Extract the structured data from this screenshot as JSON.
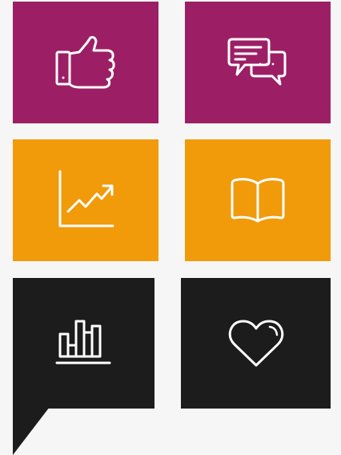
{
  "colors": {
    "background": "#f6f6f6",
    "magenta": "#9c1f66",
    "orange": "#f19a0a",
    "black": "#1c1c1c",
    "icon_stroke": "#ffffff"
  },
  "tiles": [
    {
      "name": "like-tile",
      "color": "magenta",
      "icon": "thumbs-up-icon"
    },
    {
      "name": "chat-tile",
      "color": "magenta",
      "icon": "chat-bubbles-icon"
    },
    {
      "name": "growth-tile",
      "color": "orange",
      "icon": "line-chart-icon"
    },
    {
      "name": "book-tile",
      "color": "orange",
      "icon": "open-book-icon"
    },
    {
      "name": "stats-tile",
      "color": "black",
      "icon": "bar-chart-icon",
      "has_speech_tail": true
    },
    {
      "name": "heart-tile",
      "color": "black",
      "icon": "heart-icon"
    }
  ]
}
